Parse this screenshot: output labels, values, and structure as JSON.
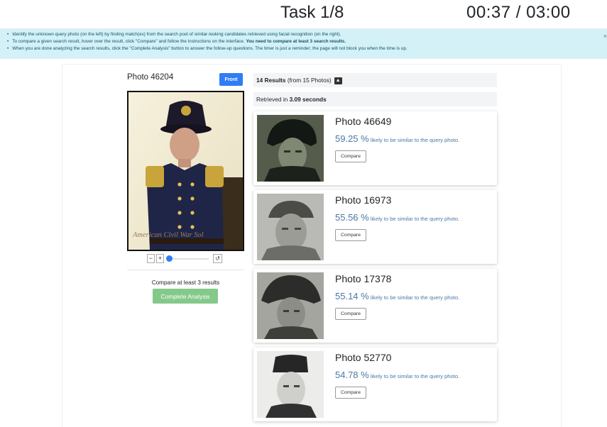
{
  "header": {
    "task": "Task 1/8",
    "timer": "00:37 / 03:00"
  },
  "instructions": {
    "line1": "Identify the unknown query photo (on the left) by finding match(es) from the search pool of similar-looking candidates retrieved using facial recognition (on the right).",
    "line2_pre": "To compare a given search result, hover over the result, click \"Compare\" and follow the instructions on the interface. ",
    "line2_bold": "You need to compare at least 3 search results.",
    "line3": "When you are done analyzing the search results, click the \"Complete Analysis\" button to answer the follow-up questions. The timer is just a reminder; the page will not block you when the time is up.",
    "close": "×"
  },
  "query": {
    "title": "Photo 46204",
    "front_label": "Front",
    "watermark": "American Civil War Sol",
    "zoom_out": "−",
    "zoom_in": "+",
    "rotate": "↺",
    "hint": "Compare at least 3 results",
    "complete_label": "Complete Analysis"
  },
  "results": {
    "count": "14 Results",
    "from": " (from 15 Photos)",
    "retrieved_pre": "Retrieved in ",
    "retrieved_time": "3.09 seconds",
    "items": [
      {
        "title": "Photo 46649",
        "pct": "59.25 %",
        "desc": " likely to be similar to the query photo.",
        "compare": "Compare"
      },
      {
        "title": "Photo 16973",
        "pct": "55.56 %",
        "desc": " likely to be similar to the query photo.",
        "compare": "Compare"
      },
      {
        "title": "Photo 17378",
        "pct": "55.14 %",
        "desc": " likely to be similar to the query photo.",
        "compare": "Compare"
      },
      {
        "title": "Photo 52770",
        "pct": "54.78 %",
        "desc": " likely to be similar to the query photo.",
        "compare": "Compare"
      }
    ]
  },
  "colors": {
    "primary": "#2f7cf6",
    "success": "#85c98a",
    "info_bg": "#d5f1f8",
    "score_text": "#4a78a6"
  }
}
